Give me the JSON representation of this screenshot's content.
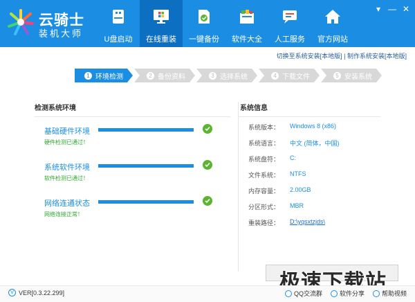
{
  "app": {
    "title": "云骑士",
    "subtitle": "装机大师"
  },
  "nav": {
    "items": [
      {
        "label": "U盘启动",
        "icon": "usb-icon"
      },
      {
        "label": "在线重装",
        "icon": "monitor-windows-icon",
        "active": true
      },
      {
        "label": "一键备份",
        "icon": "backup-icon"
      },
      {
        "label": "软件大全",
        "icon": "software-box-icon"
      },
      {
        "label": "人工服务",
        "icon": "chat-service-icon"
      },
      {
        "label": "官方网站",
        "icon": "home-icon"
      }
    ]
  },
  "window": {
    "dropdown": "▾",
    "minimize": "—",
    "close": "✕"
  },
  "sub_links": {
    "switch_local": "切换至系统安装[本地版]",
    "separator": "|",
    "make_local": "制作系统安装[本地版]"
  },
  "steps": [
    {
      "num": "1",
      "label": "环境检测",
      "active": true
    },
    {
      "num": "2",
      "label": "备份资料"
    },
    {
      "num": "3",
      "label": "选择系统"
    },
    {
      "num": "4",
      "label": "下载文件"
    },
    {
      "num": "5",
      "label": "安装系统"
    }
  ],
  "env_panel": {
    "title": "检测系统环境",
    "checks": [
      {
        "title": "基础硬件环境",
        "status": "硬件检测已通过！",
        "progress": 1.0
      },
      {
        "title": "系统软件环境",
        "status": "软件检测已通过！",
        "progress": 1.0
      },
      {
        "title": "网络连通状态",
        "status": "网络连接正常！",
        "progress": 1.0
      }
    ]
  },
  "info_panel": {
    "title": "系统信息",
    "rows": [
      {
        "key": "系统版本：",
        "value": "Windows 8 (x86)"
      },
      {
        "key": "系统语言：",
        "value": "中文 (简体，中国)"
      },
      {
        "key": "系统盘符：",
        "value": "C:"
      },
      {
        "key": "文件系统：",
        "value": "NTFS"
      },
      {
        "key": "内存容量：",
        "value": "2.00GB"
      },
      {
        "key": "分区形式：",
        "value": "MBR"
      },
      {
        "key": "重装路径：",
        "value": "D:\\yqsxtzjds\\",
        "link": true
      }
    ]
  },
  "watermark": "极速下载站",
  "footer": {
    "version": "VER[0.3.22.299]",
    "links": [
      {
        "label": "QQ交流群",
        "icon": "qq-icon"
      },
      {
        "label": "软件分享",
        "icon": "share-icon"
      },
      {
        "label": "帮助视频",
        "icon": "help-video-icon"
      }
    ]
  },
  "colors": {
    "brand": "#1b8ee3",
    "nav_active": "#0d6fc2",
    "ok_green": "#5cb531",
    "status_green": "#2fa82f"
  }
}
